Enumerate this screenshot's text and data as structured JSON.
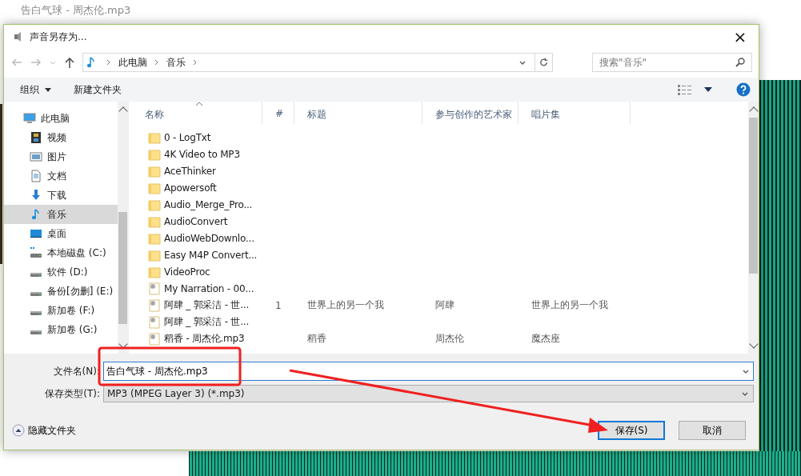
{
  "background_app": {
    "title": "告白气球 - 周杰伦.mp3"
  },
  "dialog": {
    "title": "声音另存为...",
    "close": "×"
  },
  "address_bar": {
    "crumbs": [
      "此电脑",
      "音乐"
    ],
    "search": {
      "placeholder": "搜索\"音乐\""
    }
  },
  "toolbar": {
    "organize": "组织",
    "new_folder": "新建文件夹"
  },
  "sidebar": {
    "items": [
      {
        "label": "此电脑",
        "kind": "pc",
        "selected": false,
        "children": [
          {
            "label": "视频",
            "kind": "video",
            "selected": false
          },
          {
            "label": "图片",
            "kind": "picture",
            "selected": false
          },
          {
            "label": "文档",
            "kind": "document",
            "selected": false
          },
          {
            "label": "下载",
            "kind": "download",
            "selected": false
          },
          {
            "label": "音乐",
            "kind": "music",
            "selected": true
          },
          {
            "label": "桌面",
            "kind": "desktop",
            "selected": false
          },
          {
            "label": "本地磁盘 (C:)",
            "kind": "system-drive",
            "selected": false
          },
          {
            "label": "软件 (D:)",
            "kind": "drive",
            "selected": false
          },
          {
            "label": "备份[勿删] (E:)",
            "kind": "drive",
            "selected": false
          },
          {
            "label": "新加卷 (F:)",
            "kind": "drive",
            "selected": false
          },
          {
            "label": "新加卷 (G:)",
            "kind": "drive",
            "selected": false
          }
        ]
      }
    ]
  },
  "file_list": {
    "columns": [
      "名称",
      "#",
      "标题",
      "参与创作的艺术家",
      "唱片集"
    ],
    "rows": [
      {
        "kind": "folder",
        "cells": [
          "0 - LogTxt",
          "",
          "",
          "",
          ""
        ]
      },
      {
        "kind": "folder",
        "cells": [
          "4K Video to MP3",
          "",
          "",
          "",
          ""
        ]
      },
      {
        "kind": "folder",
        "cells": [
          "AceThinker",
          "",
          "",
          "",
          ""
        ]
      },
      {
        "kind": "folder",
        "cells": [
          "Apowersoft",
          "",
          "",
          "",
          ""
        ]
      },
      {
        "kind": "folder",
        "cells": [
          "Audio_Merge_Pro...",
          "",
          "",
          "",
          ""
        ]
      },
      {
        "kind": "folder",
        "cells": [
          "AudioConvert",
          "",
          "",
          "",
          ""
        ]
      },
      {
        "kind": "folder",
        "cells": [
          "AudioWebDownlo...",
          "",
          "",
          "",
          ""
        ]
      },
      {
        "kind": "folder",
        "cells": [
          "Easy M4P Convert...",
          "",
          "",
          "",
          ""
        ]
      },
      {
        "kind": "folder",
        "cells": [
          "VideoProc",
          "",
          "",
          "",
          ""
        ]
      },
      {
        "kind": "audio",
        "cells": [
          "My Narration - 00...",
          "",
          "",
          "",
          ""
        ]
      },
      {
        "kind": "audio",
        "cells": [
          "阿肆 _ 郭采洁 - 世...",
          "1",
          "世界上的另一个我",
          "阿肆",
          "世界上的另一个我"
        ]
      },
      {
        "kind": "audio",
        "cells": [
          "阿肆 _ 郭采洁 - 世...",
          "",
          "",
          "",
          ""
        ]
      },
      {
        "kind": "audio",
        "cells": [
          "稻香 - 周杰伦.mp3",
          "",
          "稻香",
          "周杰伦",
          "魔杰座"
        ]
      }
    ]
  },
  "form": {
    "filename_label": "文件名(N):",
    "filename": "告白气球 - 周杰伦.mp3",
    "type_label": "保存类型(T):",
    "type": "MP3 (MPEG Layer 3) (*.mp3)"
  },
  "footer": {
    "hide_folders": "隐藏文件夹",
    "buttons": [
      {
        "label": "保存(S)",
        "kind": "primary"
      },
      {
        "label": "取消",
        "kind": "normal"
      }
    ]
  }
}
